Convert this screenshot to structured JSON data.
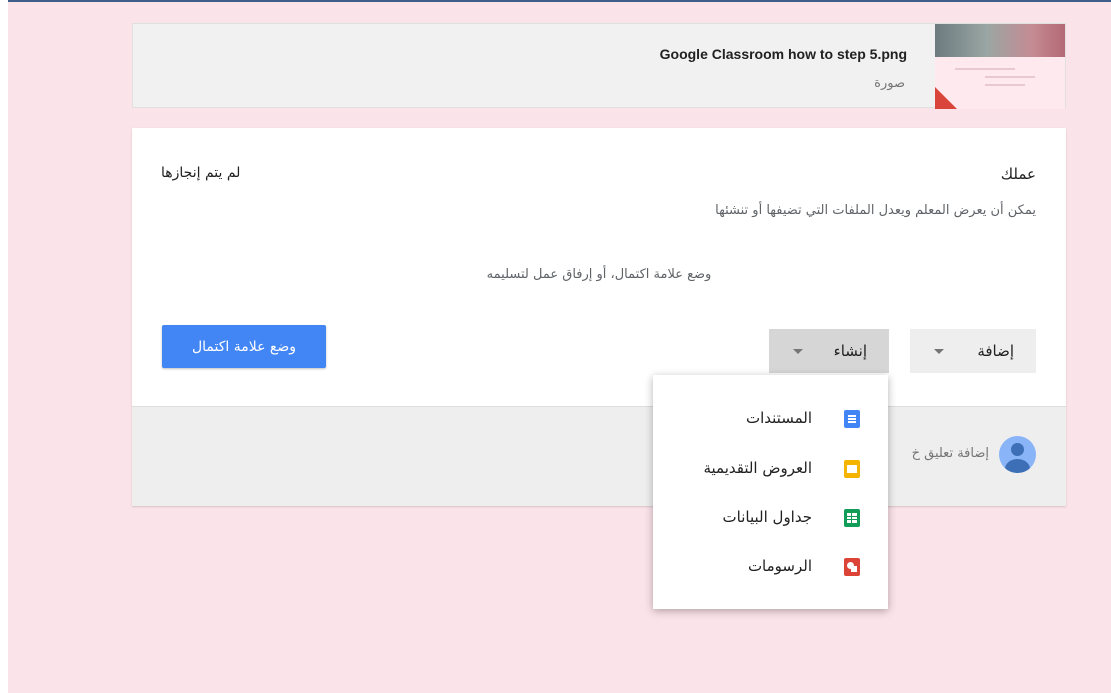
{
  "attachment": {
    "file_name": "Google Classroom how to step 5.png",
    "file_type": "صورة"
  },
  "work": {
    "heading": "عملك",
    "status": "لم يتم إنجازها",
    "description": "يمكن أن يعرض المعلم ويعدل الملفات التي تضيفها أو تنشئها",
    "hint": "وضع علامة اكتمال، أو إرفاق عمل لتسليمه",
    "add_label": "إضافة",
    "create_label": "إنشاء",
    "mark_done_label": "وضع علامة اكتمال",
    "comment_placeholder": "إضافة تعليق خ"
  },
  "create_menu": {
    "items": [
      {
        "label": "المستندات",
        "icon": "docs-icon",
        "color": "#4285f4"
      },
      {
        "label": "العروض التقديمية",
        "icon": "slides-icon",
        "color": "#f4b400"
      },
      {
        "label": "جداول البيانات",
        "icon": "sheets-icon",
        "color": "#0f9d58"
      },
      {
        "label": "الرسومات",
        "icon": "drawings-icon",
        "color": "#db4437"
      }
    ]
  },
  "colors": {
    "page_background": "#fbe3ea",
    "primary_button": "#4285f4"
  }
}
